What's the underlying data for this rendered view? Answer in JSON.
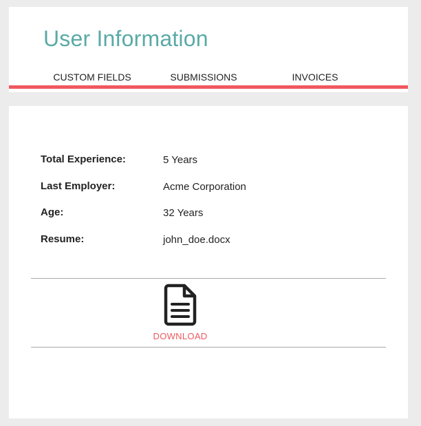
{
  "page": {
    "title": "User Information"
  },
  "tabs": [
    {
      "label": "CUSTOM FIELDS"
    },
    {
      "label": "SUBMISSIONS"
    },
    {
      "label": "INVOICES"
    }
  ],
  "details": [
    {
      "label": "Total Experience:",
      "value": "5 Years"
    },
    {
      "label": "Last Employer:",
      "value": "Acme Corporation"
    },
    {
      "label": "Age:",
      "value": "32 Years"
    },
    {
      "label": "Resume:",
      "value": "john_doe.docx"
    }
  ],
  "download": {
    "label": "DOWNLOAD",
    "icon": "document-icon"
  },
  "colors": {
    "title": "#5aaaa6",
    "accent": "#f0585f",
    "background": "#ececec"
  }
}
